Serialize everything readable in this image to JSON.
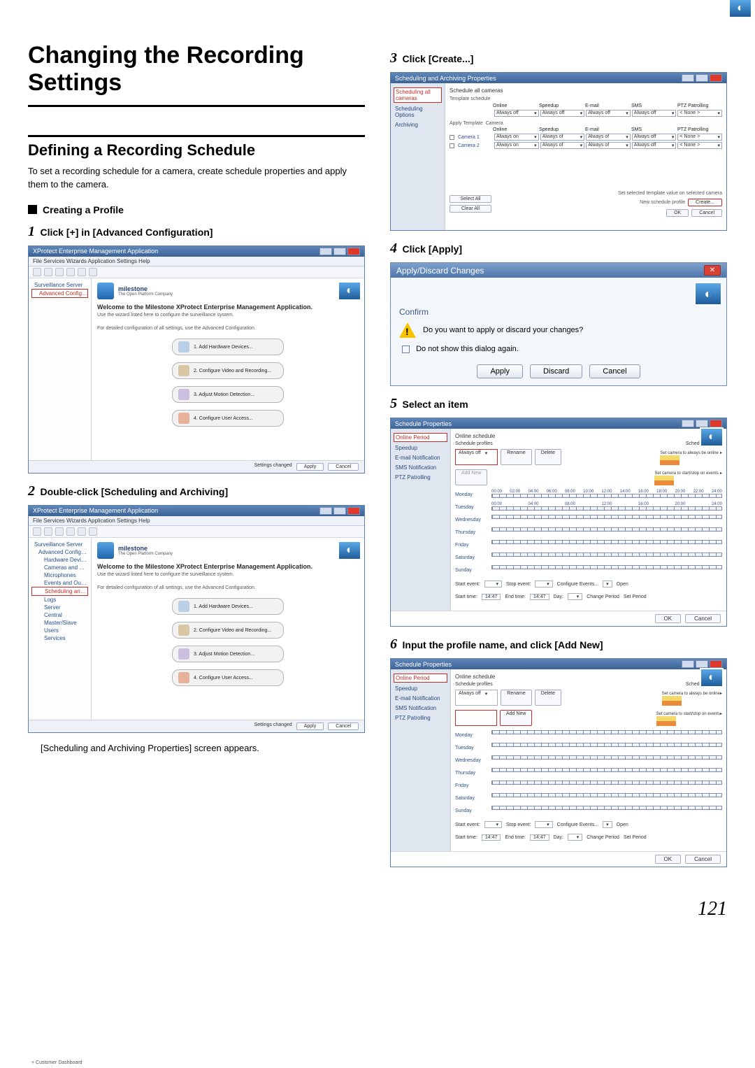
{
  "page_number": "121",
  "h1": "Changing the Recording Settings",
  "h2": "Defining a Recording Schedule",
  "intro": "To set a recording schedule for a camera, create schedule properties and apply them to the camera.",
  "sub_heading": "Creating a Profile",
  "steps": {
    "s1_num": "1",
    "s1_txt": "Click [+] in [Advanced Configuration]",
    "s2_num": "2",
    "s2_txt": "Double-click [Scheduling and Archiving]",
    "s2_note": "[Scheduling and Archiving Properties] screen appears.",
    "s3_num": "3",
    "s3_txt": "Click [Create...]",
    "s4_num": "4",
    "s4_txt": "Click [Apply]",
    "s5_num": "5",
    "s5_txt": "Select an item",
    "s6_num": "6",
    "s6_txt": "Input the profile name, and click [Add New]"
  },
  "mgmt_app": {
    "title": "XProtect Enterprise Management Application",
    "menu": "File   Services   Wizards   Application Settings   Help",
    "brand_title": "milestone",
    "brand_sub": "The Open Platform Company",
    "welcome": "Welcome to the Milestone XProtect Enterprise Management Application.",
    "welcome_sub1": "Use the wizard listed here to configure the surveillance system.",
    "welcome_sub2": "For detailed configuration of all settings, use the Advanced Configuration.",
    "tasks": {
      "t1": "1. Add Hardware Devices...",
      "t2": "2. Configure Video and Recording...",
      "t3": "3. Adjust Motion Detection...",
      "t4": "4. Configure User Access..."
    },
    "status_left": "Settings changed",
    "status_apply": "Apply",
    "status_cancel": "Cancel",
    "tree1": {
      "root": "Surveillance Server",
      "adv": "Advanced Configuration"
    },
    "tree2": {
      "root": "Surveillance Server",
      "adv": "Advanced Configuration",
      "items": [
        "Hardware Devices",
        "Cameras and Storage",
        "Microphones",
        "Events and Output"
      ],
      "sched": "Scheduling and Archiving",
      "items2": [
        "Logs",
        "Server",
        "Central",
        "Master/Slave",
        "Users",
        "Services"
      ]
    }
  },
  "sap": {
    "title": "Scheduling and Archiving Properties",
    "nav": {
      "sel": "Scheduling all cameras",
      "item1": "Scheduling Options",
      "item2": "Archiving"
    },
    "section_title": "Schedule all cameras",
    "sub_label": "Template schedule",
    "cols": [
      "Online",
      "Speedup",
      "E-mail",
      "SMS",
      "PTZ Patrolling"
    ],
    "vals_template": [
      "Always off",
      "Always off",
      "Always off",
      "Always off",
      "< None >"
    ],
    "apply_label": "Apply Template",
    "cam_label": "Camera",
    "cams": [
      {
        "name": "Camera 1",
        "vals": [
          "Always on",
          "Always of",
          "Always of",
          "Always off",
          "< None >"
        ]
      },
      {
        "name": "Camera 2",
        "vals": [
          "Always on",
          "Always of",
          "Always of",
          "Always off",
          "< None >"
        ]
      }
    ],
    "select_all": "Select All",
    "clear_all": "Clear All",
    "set_note": "Set selected template value on selected camera",
    "new_note": "New schedule profile",
    "create": "Create...",
    "ok": "OK",
    "cancel": "Cancel"
  },
  "dialog": {
    "title": "Apply/Discard Changes",
    "confirm": "Confirm",
    "msg": "Do you want to apply or discard your changes?",
    "dont_show": "Do not show this dialog again.",
    "apply": "Apply",
    "discard": "Discard",
    "cancel": "Cancel"
  },
  "sched_props": {
    "title": "Schedule Properties",
    "nav": {
      "sel": "Online Period",
      "items": [
        "Speedup",
        "E-mail Notification",
        "SMS Notification",
        "PTZ Patrolling"
      ]
    },
    "section": "Online schedule",
    "profile_label": "Schedule profiles",
    "profile_value": "Always off",
    "rename": "Rename",
    "delete": "Delete",
    "add_new": "Add New",
    "legend_title": "Schedule legend",
    "legend1_label": "Set camera to always be online",
    "legend2_label": "Set camera to start/stop on events",
    "days": [
      "Monday",
      "Tuesday",
      "Wednesday",
      "Thursday",
      "Friday",
      "Saturday",
      "Sunday"
    ],
    "time_ticks": [
      "00:00",
      "02:00",
      "04:00",
      "06:00",
      "08:00",
      "10:00",
      "12:00",
      "14:00",
      "16:00",
      "18:00",
      "20:00",
      "22:00",
      "24:00"
    ],
    "start_event": "Start event:",
    "stop_event": "Stop event:",
    "configure_events": "Configure Events...",
    "open": "Open",
    "start_time": "Start time:",
    "start_time_val": "14:47",
    "end_time": "End time:",
    "end_time_val": "14:47",
    "day_label": "Day:",
    "change_period": "Change Period",
    "set_period": "Set Period",
    "ok": "OK",
    "cancel": "Cancel"
  }
}
